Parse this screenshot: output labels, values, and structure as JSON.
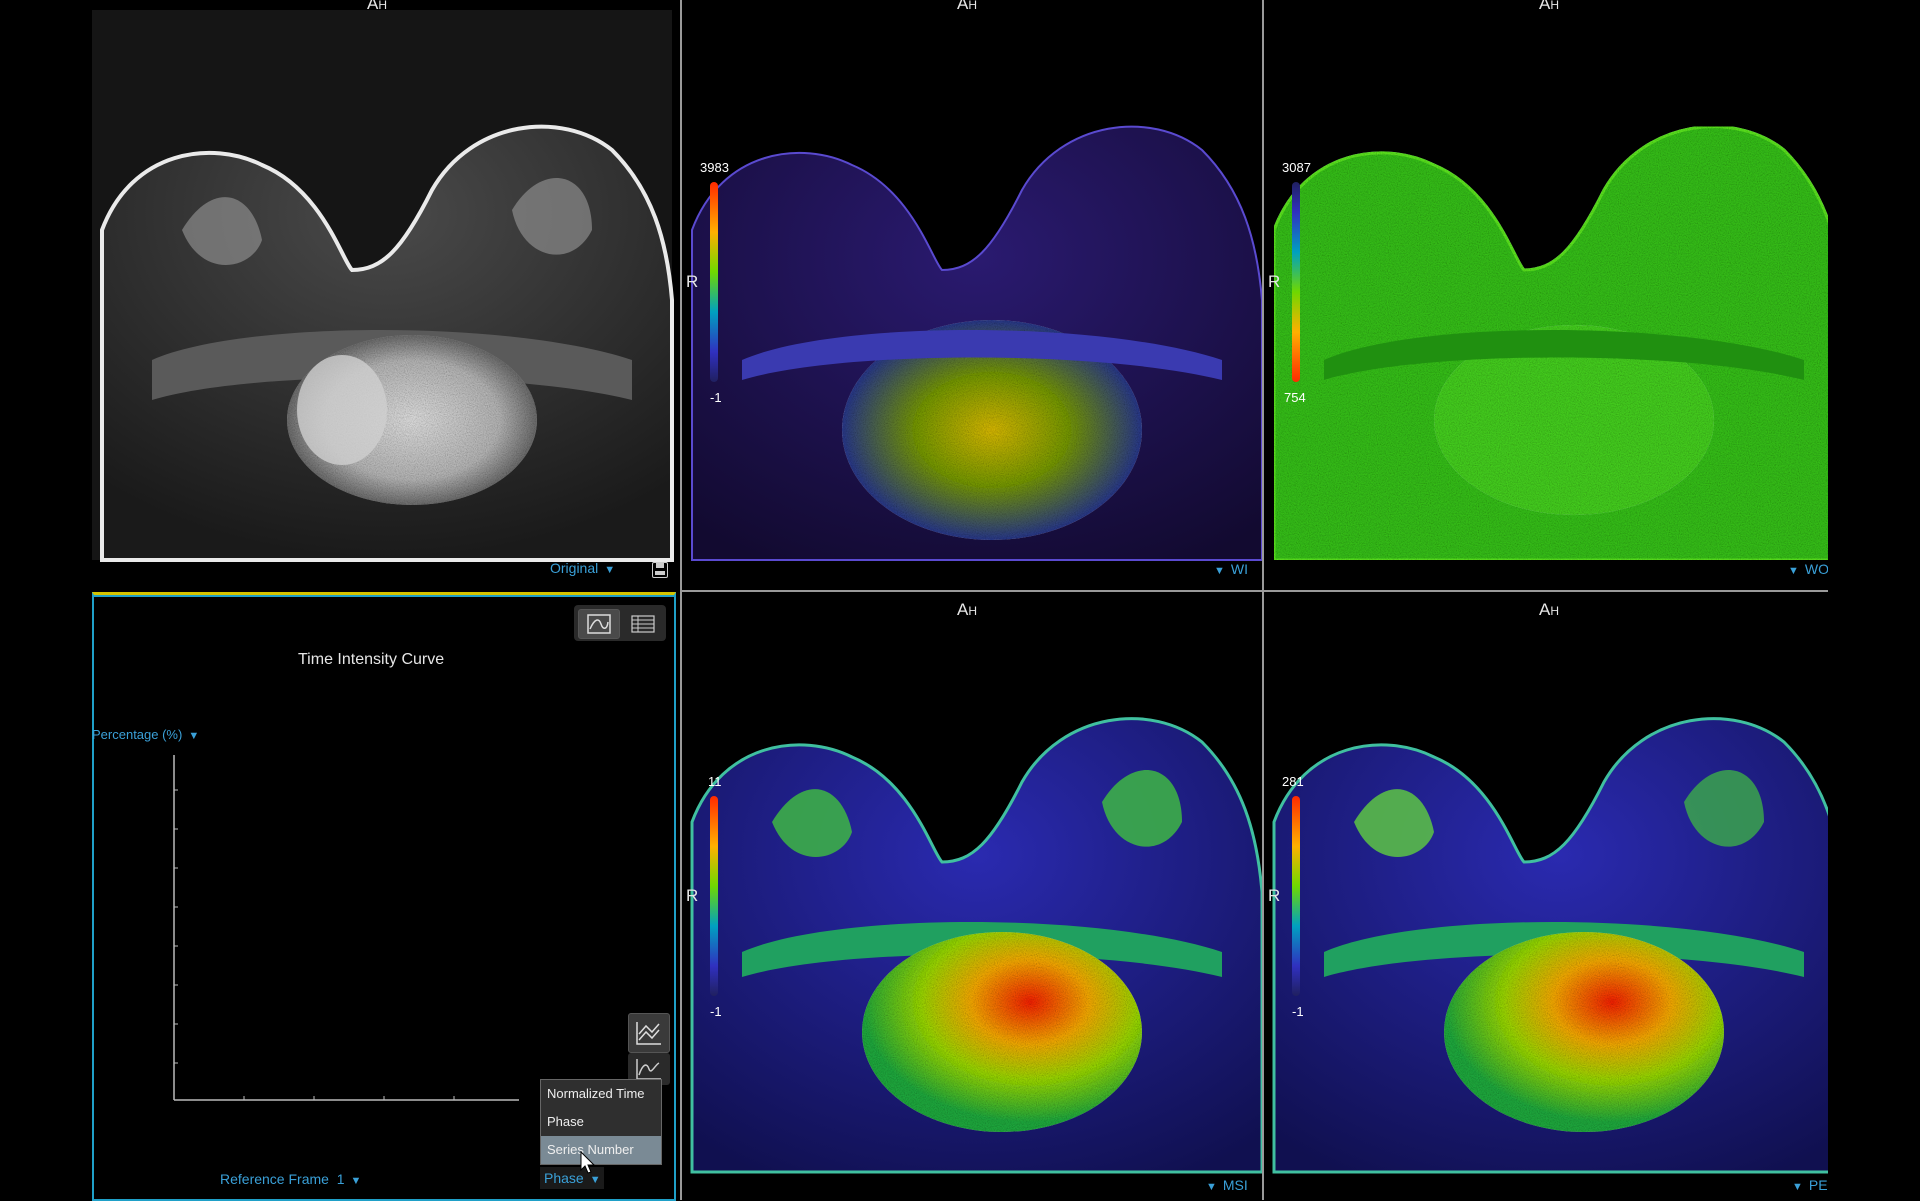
{
  "viewports": {
    "original": {
      "orientation_top": "A",
      "orientation_top_sub": "H",
      "series_label": "Original",
      "save_icon": "save-icon"
    },
    "wi": {
      "orientation_top": "A",
      "orientation_top_sub": "H",
      "orientation_left": "R",
      "colorbar_max": "3983",
      "colorbar_min": "-1",
      "series_label": "WI"
    },
    "wo": {
      "orientation_top": "A",
      "orientation_top_sub": "H",
      "orientation_left": "R",
      "colorbar_max": "3087",
      "colorbar_min": "754",
      "series_label": "WO"
    },
    "msi": {
      "orientation_top": "A",
      "orientation_top_sub": "H",
      "orientation_left": "R",
      "colorbar_max": "11",
      "colorbar_min": "-1",
      "series_label": "MSI"
    },
    "pe": {
      "orientation_top": "A",
      "orientation_top_sub": "H",
      "orientation_left": "R",
      "colorbar_max": "281",
      "colorbar_min": "-1",
      "series_label": "PE"
    }
  },
  "curve_panel": {
    "title": "Time Intensity Curve",
    "y_axis_selector": "Percentage (%)",
    "reference_frame_label": "Reference Frame",
    "reference_frame_value": "1",
    "x_axis_selector": "Phase",
    "x_axis_options": [
      "Normalized Time",
      "Phase",
      "Series Number"
    ],
    "highlighted_option": "Series Number",
    "chart_view_icon": "curve-chart-icon",
    "table_view_icon": "table-icon"
  },
  "colors": {
    "accent": "#3aa0d8",
    "panel_border_yellow": "#d4c400",
    "panel_border_cyan": "#1fa0c8",
    "divider": "#9a9a9a"
  }
}
